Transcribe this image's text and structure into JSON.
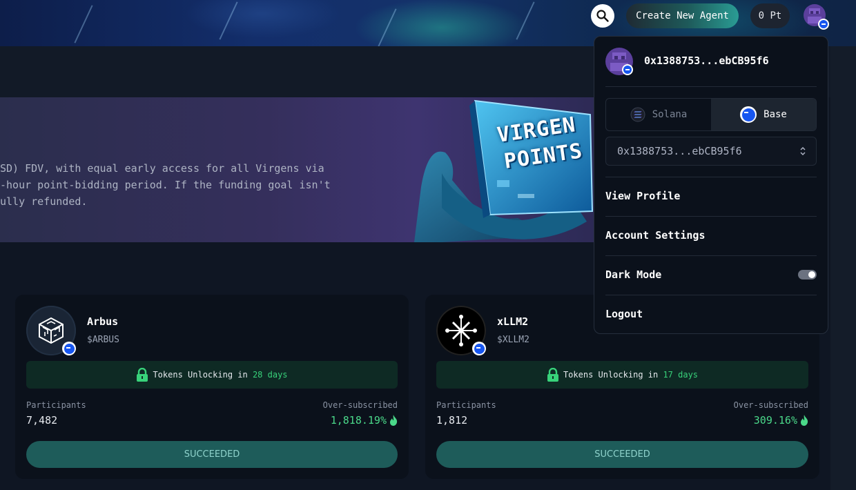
{
  "header": {
    "create_agent_label": "Create New Agent",
    "points_label": "0 Pt",
    "icons": {
      "search": "search-icon",
      "avatar": "pixel-avatar"
    }
  },
  "hero": {
    "line1": "SD) FDV, with equal early access for all Virgens via",
    "line2": "-hour point-bidding period. If the funding goal isn't",
    "line3": "ully refunded.",
    "art_line1": "VIRGEN",
    "art_line2": "POINTS"
  },
  "cards": [
    {
      "name": "Arbus",
      "ticker": "$ARBUS",
      "unlock_prefix": "Tokens Unlocking in ",
      "unlock_days": "28 days",
      "participants_label": "Participants",
      "participants": "7,482",
      "oversub_label": "Over-subscribed",
      "oversub": "1,818.19%",
      "status": "SUCCEEDED"
    },
    {
      "name": "xLLM2",
      "ticker": "$XLLM2",
      "unlock_prefix": "Tokens Unlocking in ",
      "unlock_days": "17 days",
      "participants_label": "Participants",
      "participants": "1,812",
      "oversub_label": "Over-subscribed",
      "oversub": "309.16%",
      "status": "SUCCEEDED"
    }
  ],
  "dropdown": {
    "address": "0x1388753...ebCB95f6",
    "chains": [
      {
        "label": "Solana",
        "active": false
      },
      {
        "label": "Base",
        "active": true
      }
    ],
    "wallet_select_value": "0x1388753...ebCB95f6",
    "menu": {
      "view_profile": "View Profile",
      "account_settings": "Account Settings",
      "dark_mode": "Dark Mode",
      "logout": "Logout"
    },
    "dark_mode_on": true
  },
  "colors": {
    "accent_green": "#4bd98a",
    "status_button": "#1e5c5a",
    "base_blue": "#1756f0",
    "panel_bg": "#0b111b"
  }
}
